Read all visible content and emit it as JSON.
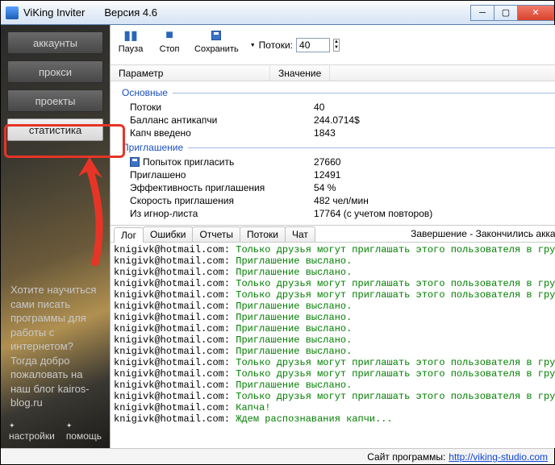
{
  "window": {
    "title": "ViKing Inviter",
    "version": "Версия 4.6"
  },
  "nav": {
    "accounts": "аккаунты",
    "proxy": "прокси",
    "projects": "проекты",
    "stats": "статистика"
  },
  "promo": "Хотите научиться сами писать программы для работы с интернетом? Тогда добро пожаловать на наш блог kairos-blog.ru",
  "sbfoot": {
    "settings": "настройки",
    "help": "помощь"
  },
  "toolbar": {
    "pause": "Пауза",
    "stop": "Стоп",
    "save": "Сохранить",
    "threads_label": "Потоки:",
    "threads_value": "40"
  },
  "columns": {
    "param": "Параметр",
    "value": "Значение"
  },
  "groups": {
    "main": "Основные",
    "invite": "Приглашение"
  },
  "stats_main": [
    {
      "label": "Потоки",
      "value": "40"
    },
    {
      "label": "Балланс антикапчи",
      "value": " 244.0714$"
    },
    {
      "label": "Капч введено",
      "value": "1843"
    }
  ],
  "stats_invite": [
    {
      "label": "Попыток пригласить",
      "value": "27660",
      "icon": true
    },
    {
      "label": "Приглашено",
      "value": "12491"
    },
    {
      "label": "Эффективность приглашения",
      "value": "54 %"
    },
    {
      "label": "Скорость приглашения",
      "value": "482 чел/мин"
    },
    {
      "label": "Из игнор-листа",
      "value": "17764 (с учетом повторов)"
    }
  ],
  "tabs": {
    "log": "Лог",
    "errors": "Ошибки",
    "reports": "Отчеты",
    "threads": "Потоки",
    "chat": "Чат"
  },
  "status_right": "Завершение - Закончились аккаунты",
  "log_lines": [
    {
      "u": "knigivk@hotmail.com",
      "m": "Только друзья могут приглашать этого пользователя в группы."
    },
    {
      "u": "knigivk@hotmail.com",
      "m": "Приглашение выслано."
    },
    {
      "u": "knigivk@hotmail.com",
      "m": "Приглашение выслано."
    },
    {
      "u": "knigivk@hotmail.com",
      "m": "Только друзья могут приглашать этого пользователя в группы."
    },
    {
      "u": "knigivk@hotmail.com",
      "m": "Только друзья могут приглашать этого пользователя в группы."
    },
    {
      "u": "knigivk@hotmail.com",
      "m": "Приглашение выслано."
    },
    {
      "u": "knigivk@hotmail.com",
      "m": "Приглашение выслано."
    },
    {
      "u": "knigivk@hotmail.com",
      "m": "Приглашение выслано."
    },
    {
      "u": "knigivk@hotmail.com",
      "m": "Приглашение выслано."
    },
    {
      "u": "knigivk@hotmail.com",
      "m": "Приглашение выслано."
    },
    {
      "u": "knigivk@hotmail.com",
      "m": "Только друзья могут приглашать этого пользователя в группы."
    },
    {
      "u": "knigivk@hotmail.com",
      "m": "Только друзья могут приглашать этого пользователя в группы."
    },
    {
      "u": "knigivk@hotmail.com",
      "m": "Приглашение выслано."
    },
    {
      "u": "knigivk@hotmail.com",
      "m": "Только друзья могут приглашать этого пользователя в группы."
    },
    {
      "u": "knigivk@hotmail.com",
      "m": "Капча!"
    },
    {
      "u": "knigivk@hotmail.com",
      "m": "Ждем распознавания капчи..."
    }
  ],
  "footer": {
    "label": "Сайт программы:",
    "url": "http://viking-studio.com"
  }
}
